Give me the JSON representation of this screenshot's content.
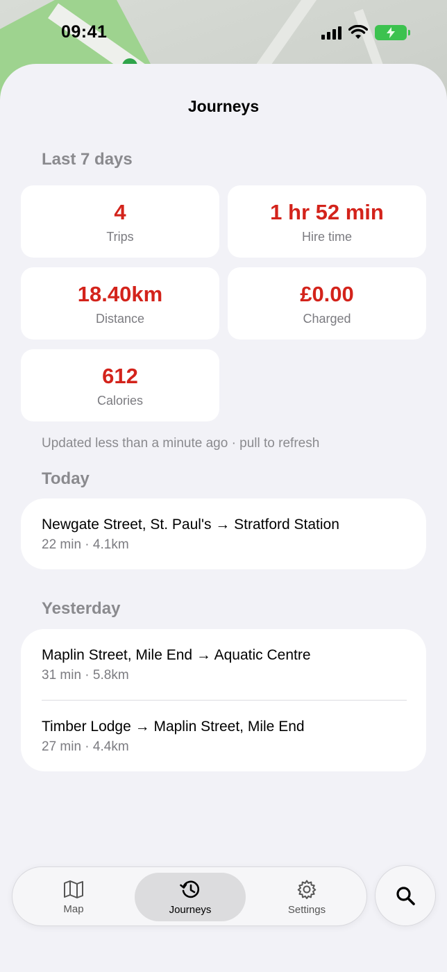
{
  "status_bar": {
    "time": "09:41"
  },
  "sheet": {
    "title": "Journeys"
  },
  "stats": {
    "section_label": "Last 7 days",
    "trips": {
      "value": "4",
      "label": "Trips"
    },
    "hire_time": {
      "value": "1 hr 52 min",
      "label": "Hire time"
    },
    "distance": {
      "value": "18.40km",
      "label": "Distance"
    },
    "charged": {
      "value": "£0.00",
      "label": "Charged"
    },
    "calories": {
      "value": "612",
      "label": "Calories"
    },
    "updated_note": "Updated less than a minute ago · pull to refresh"
  },
  "today": {
    "label": "Today",
    "journeys": [
      {
        "route": "Newgate Street, St. Paul's → Stratford Station",
        "meta": "22 min · 4.1km"
      }
    ]
  },
  "yesterday": {
    "label": "Yesterday",
    "journeys": [
      {
        "route": "Maplin Street, Mile End → Aquatic Centre",
        "meta": "31 min · 5.8km"
      },
      {
        "route": "Timber Lodge → Maplin Street, Mile End",
        "meta": "27 min · 4.4km"
      }
    ]
  },
  "tab_bar": {
    "tabs": [
      {
        "label": "Map",
        "icon": "map-icon"
      },
      {
        "label": "Journeys",
        "icon": "history-icon",
        "active": true
      },
      {
        "label": "Settings",
        "icon": "gear-icon"
      }
    ],
    "search_icon": "search-icon"
  },
  "colors": {
    "accent": "#d3231b",
    "background": "#f2f2f7",
    "battery": "#3cc24f"
  }
}
